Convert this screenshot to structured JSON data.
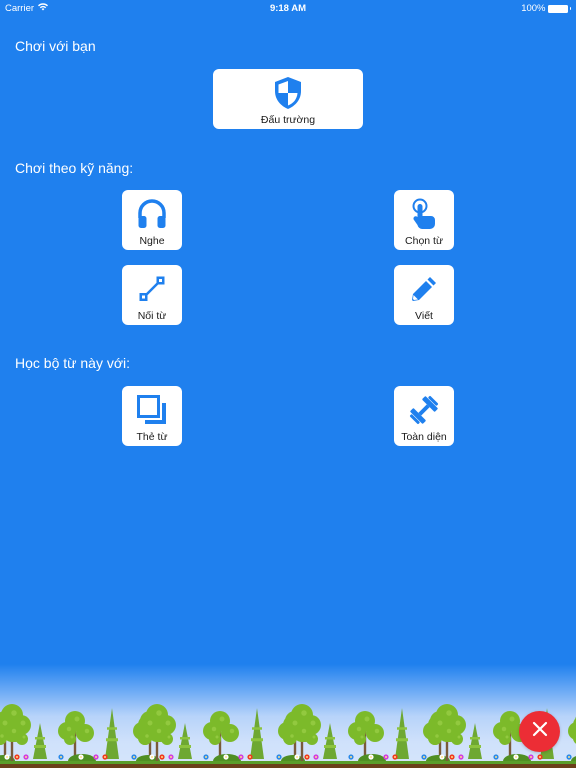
{
  "status_bar": {
    "carrier": "Carrier",
    "time": "9:18 AM",
    "battery": "100%"
  },
  "sections": {
    "play_with_friends": {
      "label": "Chơi với bạn",
      "items": [
        {
          "label": "Đấu trường",
          "icon": "shield-icon"
        }
      ]
    },
    "play_by_skill": {
      "label": "Chơi theo kỹ năng:",
      "items": [
        {
          "label": "Nghe",
          "icon": "headphones-icon"
        },
        {
          "label": "Chọn từ",
          "icon": "tap-finger-icon"
        },
        {
          "label": "Nối từ",
          "icon": "connect-line-icon"
        },
        {
          "label": "Viết",
          "icon": "pencil-icon"
        }
      ]
    },
    "study_set": {
      "label": "Học bộ từ này với:",
      "items": [
        {
          "label": "Thẻ từ",
          "icon": "flashcards-icon"
        },
        {
          "label": "Toàn diện",
          "icon": "dumbbell-icon"
        }
      ]
    }
  },
  "close_button": {
    "icon": "close-icon"
  },
  "colors": {
    "background": "#1f80ee",
    "card": "#ffffff",
    "icon": "#1f80ee",
    "close": "#ec2d35"
  }
}
